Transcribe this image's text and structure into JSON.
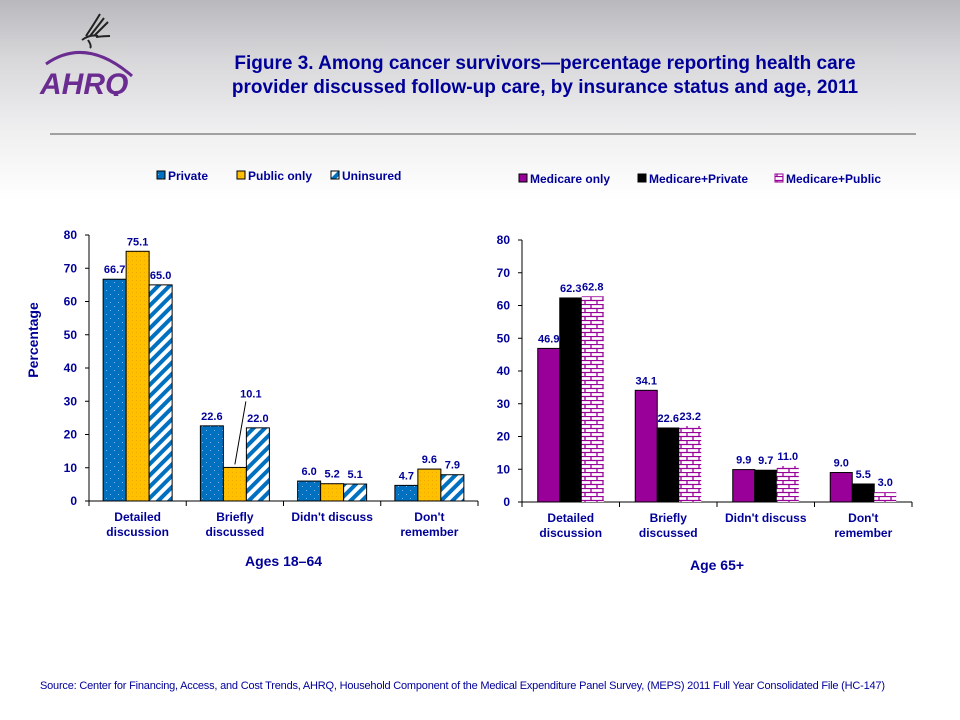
{
  "header": {
    "logo_text": "AHRQ",
    "title_line1": "Figure 3. Among cancer survivors—percentage reporting health care",
    "title_line2": "provider discussed follow-up care, by insurance status and age, 2011"
  },
  "colors": {
    "text": "#000099",
    "private": "#0070c0",
    "public_only": "#ffc000",
    "uninsured": "#0070c0",
    "medicare_only": "#990099",
    "medicare_private": "#000000",
    "medicare_public": "#990099",
    "logo": "#6b2c91"
  },
  "chart_data": [
    {
      "type": "bar",
      "title": "Ages 18–64",
      "xlabel": "Ages 18–64",
      "ylabel": "Percentage",
      "ylim": [
        0,
        80
      ],
      "yticks": [
        "0",
        "10",
        "20",
        "30",
        "40",
        "50",
        "60",
        "70",
        "80"
      ],
      "categories": [
        "Detailed discussion",
        "Briefly discussed",
        "Didn't discuss",
        "Don't remember"
      ],
      "category_lines": [
        [
          "Detailed",
          "discussion"
        ],
        [
          "Briefly",
          "discussed"
        ],
        [
          "Didn't discuss"
        ],
        [
          "Don't",
          "remember"
        ]
      ],
      "legend_position": "top",
      "series": [
        {
          "name": "Private",
          "values": [
            66.7,
            22.6,
            6.0,
            4.7
          ],
          "labels": [
            "66.7",
            "22.6",
            "6.0",
            "4.7"
          ],
          "pattern": "dots"
        },
        {
          "name": "Public only",
          "values": [
            75.1,
            10.1,
            5.2,
            9.6
          ],
          "labels": [
            "75.1",
            "10.1",
            "5.2",
            "9.6"
          ],
          "pattern": "solid"
        },
        {
          "name": "Uninsured",
          "values": [
            65.0,
            22.0,
            5.1,
            7.9
          ],
          "labels": [
            "65.0",
            "22.0",
            "5.1",
            "7.9"
          ],
          "pattern": "diagonal"
        }
      ],
      "grid": false
    },
    {
      "type": "bar",
      "title": "Age 65+",
      "xlabel": "Age 65+",
      "ylabel": "",
      "ylim": [
        0,
        80
      ],
      "yticks": [
        "0",
        "10",
        "20",
        "30",
        "40",
        "50",
        "60",
        "70",
        "80"
      ],
      "categories": [
        "Detailed discussion",
        "Briefly discussed",
        "Didn't discuss",
        "Don't remember"
      ],
      "category_lines": [
        [
          "Detailed",
          "discussion"
        ],
        [
          "Briefly",
          "discussed"
        ],
        [
          "Didn't discuss"
        ],
        [
          "Don't",
          "remember"
        ]
      ],
      "legend_position": "top",
      "series": [
        {
          "name": "Medicare only",
          "values": [
            46.9,
            34.1,
            9.9,
            9.0
          ],
          "labels": [
            "46.9",
            "34.1",
            "9.9",
            "9.0"
          ],
          "pattern": "solid"
        },
        {
          "name": "Medicare+Private",
          "values": [
            62.3,
            22.6,
            9.7,
            5.5
          ],
          "labels": [
            "62.3",
            "22.6",
            "9.7",
            "5.5"
          ],
          "pattern": "solid"
        },
        {
          "name": "Medicare+Public",
          "values": [
            62.8,
            23.2,
            11.0,
            3.0
          ],
          "labels": [
            "62.8",
            "23.2",
            "11.0",
            "3.0"
          ],
          "pattern": "brick"
        }
      ],
      "grid": false
    }
  ],
  "footer": {
    "source": "Source: Center for Financing, Access, and Cost Trends, AHRQ, Household Component of the Medical Expenditure Panel Survey,  (MEPS) 2011 Full Year Consolidated File (HC-147)"
  }
}
